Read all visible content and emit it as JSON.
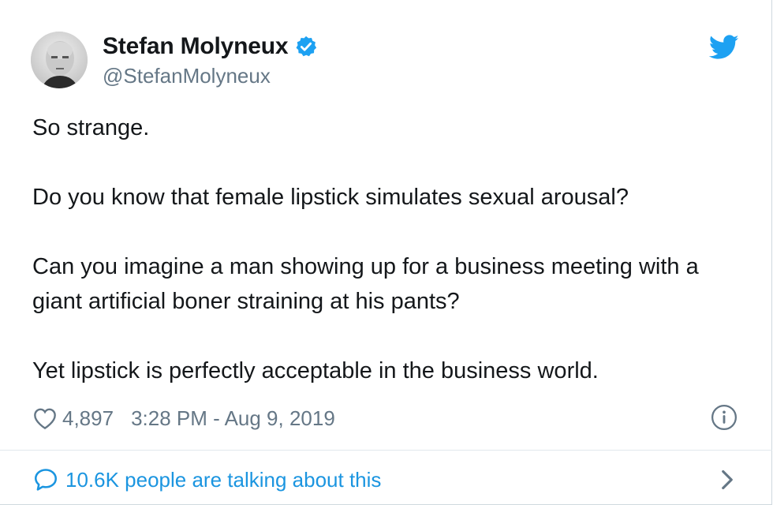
{
  "author": {
    "display_name": "Stefan Molyneux",
    "handle": "@StefanMolyneux",
    "verified": true,
    "avatar_icon": "avatar-photo"
  },
  "brand": {
    "icon": "twitter-bird-icon",
    "color": "#1da1f2"
  },
  "tweet": {
    "paragraphs": [
      "So strange.",
      "Do you know that female lipstick simulates sexual arousal?",
      "Can you imagine a man showing up for a business meeting with a giant artificial boner straining at his pants?",
      "Yet lipstick is perfectly acceptable in the business world."
    ]
  },
  "meta": {
    "like_count": "4,897",
    "timestamp": "3:28 PM - Aug 9, 2019",
    "like_icon": "heart-outline-icon",
    "info_icon": "info-circle-icon"
  },
  "footer": {
    "conversation_text": "10.6K people are talking about this",
    "conversation_icon": "speech-bubble-icon",
    "chevron_icon": "chevron-right-icon",
    "link_color": "#1b95e0"
  }
}
